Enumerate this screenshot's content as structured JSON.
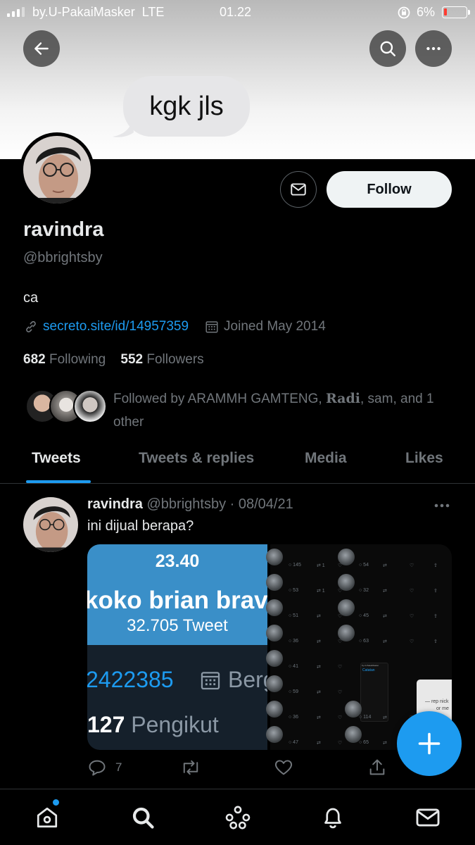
{
  "status_bar": {
    "carrier": "by.U-PakaiMasker",
    "network": "LTE",
    "time": "01.22",
    "battery_percent": "6%"
  },
  "header": {
    "banner_text": "kgk jls"
  },
  "profile": {
    "name": "ravindra",
    "handle": "@bbrightsby",
    "bio": "ca",
    "link": "secreto.site/id/14957359",
    "joined": "Joined May 2014",
    "following_count": "682",
    "following_label": "Following",
    "followers_count": "552",
    "followers_label": "Followers",
    "followed_by_prefix": "Followed by ARAMMH GAMTENG, ",
    "followed_by_radi": "Radi",
    "followed_by_suffix": ", sam, and 1 other",
    "follow_button": "Follow"
  },
  "tabs": [
    {
      "label": "Tweets",
      "active": true
    },
    {
      "label": "Tweets & replies",
      "active": false
    },
    {
      "label": "Media",
      "active": false
    },
    {
      "label": "Likes",
      "active": false
    }
  ],
  "tweet": {
    "name": "ravindra",
    "handle": "@bbrightsby",
    "separator": "·",
    "date": "08/04/21",
    "text": "ini dijual berapa?",
    "reply_count": "7",
    "media_left": {
      "time": "23.40",
      "name": "koko brian brav",
      "tweets": "32.705 Tweet",
      "number": "2422385",
      "joined_partial": "Berg",
      "followers_count": "127",
      "followers_label": "Pengikut"
    },
    "media_right_rows": [
      {
        "replies": "145",
        "retweets": "1",
        "replies2": "54"
      },
      {
        "replies": "53",
        "retweets": "1",
        "replies2": "32"
      },
      {
        "replies": "51",
        "retweets": "",
        "replies2": "45"
      },
      {
        "replies": "36",
        "retweets": "",
        "replies2": "63"
      },
      {
        "replies": "41",
        "retweets": "",
        "replies2": ""
      },
      {
        "replies": "59",
        "retweets": "",
        "replies2": ""
      },
      {
        "replies": "36",
        "retweets": "",
        "replies2": "114"
      },
      {
        "replies": "47",
        "retweets": "",
        "replies2": "65"
      }
    ],
    "media_right_chat": {
      "status": "by.U-PakaiMasker",
      "back_label": "Catatan",
      "note": "— rep nick",
      "note2": "or me"
    }
  },
  "colors": {
    "accent": "#1d9bf0",
    "background": "#000000",
    "text_primary": "#e7e9ea",
    "text_secondary": "#71767b"
  },
  "icons": {
    "back": "arrow-left-icon",
    "search": "search-icon",
    "more": "more-horizontal-icon",
    "message": "envelope-icon",
    "link": "link-icon",
    "calendar": "calendar-icon",
    "compose": "plus-icon",
    "nav": [
      "home-icon",
      "search-icon",
      "spaces-icon",
      "bell-icon",
      "envelope-icon"
    ]
  }
}
